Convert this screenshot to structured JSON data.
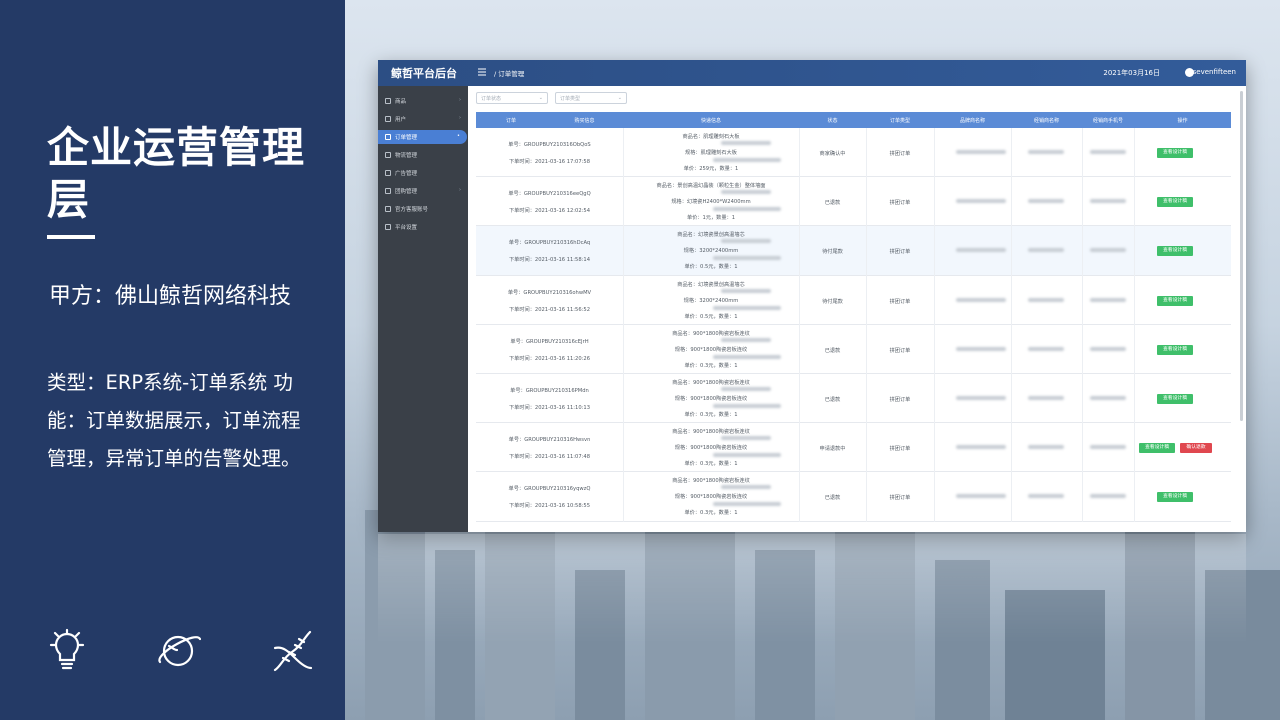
{
  "left": {
    "title": "企业运营管理层",
    "party": "甲方：佛山鲸哲网络科技",
    "desc": "类型：ERP系统-订单系统 功能：订单数据展示，订单流程管理，异常订单的告警处理。",
    "icons": [
      "lightbulb-icon",
      "planet-icon",
      "dna-icon"
    ]
  },
  "app": {
    "brand": "鲸哲平台后台",
    "breadcrumb": "/ 订单管理",
    "date": "2021年03月16日",
    "user": "sevenfifteen",
    "sidebar": [
      {
        "label": "商品",
        "icon": "goods-icon",
        "arrow": "›"
      },
      {
        "label": "用户",
        "icon": "user-icon",
        "arrow": "›"
      },
      {
        "label": "订单管理",
        "icon": "order-icon",
        "arrow": "•",
        "active": true
      },
      {
        "label": "物流管理",
        "icon": "logistics-icon",
        "arrow": ""
      },
      {
        "label": "广告管理",
        "icon": "ad-icon",
        "arrow": ""
      },
      {
        "label": "团购管理",
        "icon": "group-icon",
        "arrow": "›"
      },
      {
        "label": "官方客服账号",
        "icon": "service-icon",
        "arrow": ""
      },
      {
        "label": "平台设置",
        "icon": "settings-icon",
        "arrow": ""
      }
    ],
    "filters": {
      "status": "订单状态",
      "type": "订单类型"
    },
    "headers": [
      "订单",
      "购买信息",
      "快递信息",
      "状态",
      "订单类型",
      "品牌商名称",
      "经销商名称",
      "经销商手机号",
      "操作"
    ],
    "rows": [
      {
        "no": "单号：GROUPBUY210316ObQoS",
        "time": "下单时间：2021-03-16 17:07:58",
        "goods": "商品名：肌理雕刻石大板",
        "spec": "规格：肌理雕刻石大板",
        "price": "单价：259元，数量：1",
        "status": "商家确认中",
        "type": "拼团订单",
        "actions": [
          "查看设计稿"
        ]
      },
      {
        "no": "单号：GROUPBUY210316eeQgQ",
        "time": "下单时间：2021-03-16 12:02:54",
        "goods": "商品名：景创高温幻晶装（颗粒生金）整体墙面",
        "spec": "规格：幻境瓷H2400*W2400mm",
        "price": "单价：1元，数量：1",
        "status": "已退款",
        "type": "拼团订单",
        "actions": [
          "查看设计稿"
        ]
      },
      {
        "no": "单号：GROUPBUY210316hDcAq",
        "time": "下单时间：2021-03-16 11:58:14",
        "goods": "商品名：幻境瓷景创高温墙芯",
        "spec": "规格：3200*2400mm",
        "price": "单价：0.5元，数量：1",
        "status": "待付尾款",
        "type": "拼团订单",
        "actions": [
          "查看设计稿"
        ]
      },
      {
        "no": "单号：GROUPBUY210316ohwMV",
        "time": "下单时间：2021-03-16 11:56:52",
        "goods": "商品名：幻境瓷景创高温墙芯",
        "spec": "规格：3200*2400mm",
        "price": "单价：0.5元，数量：1",
        "status": "待付尾款",
        "type": "拼团订单",
        "actions": [
          "查看设计稿"
        ]
      },
      {
        "no": "单号：GROUPBUY210316cEJrH",
        "time": "下单时间：2021-03-16 11:20:26",
        "goods": "商品名：900*1800陶瓷岩板连纹",
        "spec": "规格：900*1800陶瓷岩板连纹",
        "price": "单价：0.3元，数量：1",
        "status": "已退款",
        "type": "拼团订单",
        "actions": [
          "查看设计稿"
        ]
      },
      {
        "no": "单号：GROUPBUY210316PMdn",
        "time": "下单时间：2021-03-16 11:10:13",
        "goods": "商品名：900*1800陶瓷岩板连纹",
        "spec": "规格：900*1800陶瓷岩板连纹",
        "price": "单价：0.3元，数量：1",
        "status": "已退款",
        "type": "拼团订单",
        "actions": [
          "查看设计稿"
        ]
      },
      {
        "no": "单号：GROUPBUY210316Hwsvn",
        "time": "下单时间：2021-03-16 11:07:48",
        "goods": "商品名：900*1800陶瓷岩板连纹",
        "spec": "规格：900*1800陶瓷岩板连纹",
        "price": "单价：0.3元，数量：1",
        "status": "申请退款中",
        "type": "拼团订单",
        "actions": [
          "查看设计稿",
          "确认退款"
        ]
      },
      {
        "no": "单号：GROUPBUY210316yqwzQ",
        "time": "下单时间：2021-03-16 10:58:55",
        "goods": "商品名：900*1800陶瓷岩板连纹",
        "spec": "规格：900*1800陶瓷岩板连纹",
        "price": "单价：0.3元，数量：1",
        "status": "已退款",
        "type": "拼团订单",
        "actions": [
          "查看设计稿"
        ]
      }
    ]
  },
  "colors": {
    "panel": "#243a66",
    "topbar": "#2c4e84",
    "header": "#5b8bd6",
    "green": "#3fbf6a",
    "red": "#e0474f"
  }
}
